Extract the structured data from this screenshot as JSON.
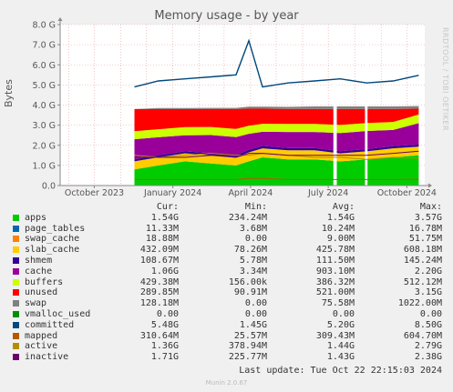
{
  "title": "Memory usage - by year",
  "side_label": "RRDTOOL / TOBI OETIKER",
  "ylabel": "Bytes",
  "last_update": "Last update: Tue Oct 22 22:15:03 2024",
  "footer": "Munin 2.0.67",
  "legend_headers": {
    "cur": "Cur:",
    "min": "Min:",
    "avg": "Avg:",
    "max": "Max:"
  },
  "legend": [
    {
      "name": "apps",
      "color": "#00cc00",
      "cur": "1.54G",
      "min": "234.24M",
      "avg": "1.54G",
      "max": "3.57G"
    },
    {
      "name": "page_tables",
      "color": "#0066b3",
      "cur": "11.33M",
      "min": "3.68M",
      "avg": "10.24M",
      "max": "16.78M"
    },
    {
      "name": "swap_cache",
      "color": "#ff8000",
      "cur": "18.88M",
      "min": "0.00",
      "avg": "9.00M",
      "max": "51.75M"
    },
    {
      "name": "slab_cache",
      "color": "#ffcc00",
      "cur": "432.09M",
      "min": "78.26M",
      "avg": "425.78M",
      "max": "608.18M"
    },
    {
      "name": "shmem",
      "color": "#330099",
      "cur": "108.67M",
      "min": "5.78M",
      "avg": "111.50M",
      "max": "145.24M"
    },
    {
      "name": "cache",
      "color": "#990099",
      "cur": "1.06G",
      "min": "3.34M",
      "avg": "903.10M",
      "max": "2.20G"
    },
    {
      "name": "buffers",
      "color": "#ccff00",
      "cur": "429.38M",
      "min": "156.00k",
      "avg": "386.32M",
      "max": "512.12M"
    },
    {
      "name": "unused",
      "color": "#ff0000",
      "cur": "289.85M",
      "min": "90.91M",
      "avg": "521.00M",
      "max": "3.15G"
    },
    {
      "name": "swap",
      "color": "#808080",
      "cur": "128.18M",
      "min": "0.00",
      "avg": "75.58M",
      "max": "1022.00M"
    },
    {
      "name": "vmalloc_used",
      "color": "#008f00",
      "cur": "0.00",
      "min": "0.00",
      "avg": "0.00",
      "max": "0.00"
    },
    {
      "name": "committed",
      "color": "#00487d",
      "cur": "5.48G",
      "min": "1.45G",
      "avg": "5.20G",
      "max": "8.50G"
    },
    {
      "name": "mapped",
      "color": "#b35a00",
      "cur": "310.64M",
      "min": "25.57M",
      "avg": "309.43M",
      "max": "604.70M"
    },
    {
      "name": "active",
      "color": "#b38f00",
      "cur": "1.36G",
      "min": "378.94M",
      "avg": "1.44G",
      "max": "2.79G"
    },
    {
      "name": "inactive",
      "color": "#6b006b",
      "cur": "1.71G",
      "min": "225.77M",
      "avg": "1.43G",
      "max": "2.38G"
    }
  ],
  "chart_data": {
    "type": "area",
    "title": "Memory usage - by year",
    "ylabel": "Bytes",
    "y_unit": "GB",
    "ylim": [
      0,
      8
    ],
    "y_ticks": [
      0,
      1,
      2,
      3,
      4,
      5,
      6,
      7,
      8
    ],
    "y_tick_labels": [
      "0.0",
      "1.0 G",
      "2.0 G",
      "3.0 G",
      "4.0 G",
      "5.0 G",
      "6.0 G",
      "7.0 G",
      "8.0 G"
    ],
    "x_ticks": [
      "2023-10-01",
      "2024-01-01",
      "2024-04-01",
      "2024-07-01",
      "2024-10-01"
    ],
    "x_tick_labels": [
      "October 2023",
      "January 2024",
      "April 2024",
      "July 2024",
      "October 2024"
    ],
    "xlim": [
      "2023-08-22",
      "2024-10-22"
    ],
    "grid": true,
    "x": [
      "2023-11-17",
      "2023-12-15",
      "2024-01-15",
      "2024-02-15",
      "2024-03-15",
      "2024-03-30",
      "2024-04-15",
      "2024-05-15",
      "2024-06-15",
      "2024-07-15",
      "2024-08-15",
      "2024-09-15",
      "2024-10-15"
    ],
    "series": [
      {
        "name": "apps",
        "stacked": true,
        "values": [
          0.8,
          1.0,
          1.2,
          1.1,
          1.0,
          1.2,
          1.4,
          1.3,
          1.3,
          1.2,
          1.3,
          1.4,
          1.5
        ]
      },
      {
        "name": "slab_cache",
        "stacked": true,
        "values": [
          0.4,
          0.4,
          0.4,
          0.4,
          0.4,
          0.45,
          0.45,
          0.45,
          0.45,
          0.4,
          0.4,
          0.45,
          0.43
        ]
      },
      {
        "name": "shmem",
        "stacked": true,
        "values": [
          0.1,
          0.1,
          0.1,
          0.11,
          0.11,
          0.12,
          0.12,
          0.11,
          0.11,
          0.11,
          0.11,
          0.11,
          0.11
        ]
      },
      {
        "name": "cache",
        "stacked": true,
        "values": [
          1.0,
          0.9,
          0.8,
          0.9,
          0.9,
          0.8,
          0.7,
          0.8,
          0.8,
          0.9,
          0.9,
          0.8,
          1.06
        ]
      },
      {
        "name": "buffers",
        "stacked": true,
        "values": [
          0.4,
          0.4,
          0.4,
          0.4,
          0.4,
          0.4,
          0.4,
          0.4,
          0.4,
          0.4,
          0.4,
          0.4,
          0.43
        ]
      },
      {
        "name": "unused",
        "stacked": true,
        "values": [
          1.1,
          1.0,
          0.9,
          0.9,
          1.0,
          0.85,
          0.75,
          0.75,
          0.75,
          0.8,
          0.7,
          0.65,
          0.29
        ]
      },
      {
        "name": "swap",
        "stacked": true,
        "values": [
          0.0,
          0.05,
          0.05,
          0.05,
          0.05,
          0.1,
          0.1,
          0.1,
          0.12,
          0.12,
          0.12,
          0.12,
          0.13
        ]
      },
      {
        "name": "committed",
        "stacked": false,
        "values": [
          4.9,
          5.2,
          5.3,
          5.4,
          5.5,
          7.2,
          4.9,
          5.1,
          5.2,
          5.3,
          5.1,
          5.2,
          5.48
        ]
      },
      {
        "name": "active",
        "stacked": false,
        "values": [
          1.5,
          1.4,
          1.5,
          1.6,
          1.5,
          1.5,
          1.6,
          1.5,
          1.4,
          1.4,
          1.3,
          1.4,
          1.36
        ]
      },
      {
        "name": "inactive",
        "stacked": false,
        "values": [
          1.4,
          1.4,
          1.4,
          1.5,
          1.4,
          1.6,
          1.6,
          1.5,
          1.5,
          1.5,
          1.5,
          1.6,
          1.71
        ]
      },
      {
        "name": "mapped",
        "stacked": false,
        "values": [
          0.3,
          0.3,
          0.3,
          0.3,
          0.3,
          0.35,
          0.35,
          0.3,
          0.3,
          0.3,
          0.3,
          0.3,
          0.31
        ]
      }
    ],
    "gaps": [
      [
        "2024-07-07",
        "2024-07-11"
      ],
      [
        "2024-08-13",
        "2024-08-16"
      ]
    ]
  }
}
